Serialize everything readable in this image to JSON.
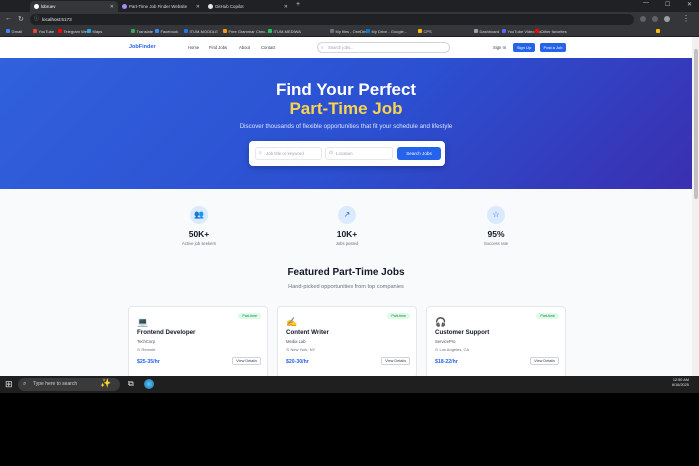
{
  "browser": {
    "tabs": [
      {
        "label": "lobruev",
        "active": true
      },
      {
        "label": "Part-Time Job Finder Website",
        "active": false
      },
      {
        "label": "GitHub Copilot",
        "active": false
      }
    ],
    "url": "localhost:5173",
    "bookmarks": [
      "Gmail",
      "YouTube",
      "Telegram Web",
      "Maps",
      "Translate",
      "Facebook",
      "ITUM-MOODLE",
      "Free Grammar Chec...",
      "ITUM-MEDIWA",
      "My files - OneDrive",
      "My Drive - Google...",
      "CPS",
      "Dashboard",
      "YouTube Video Do...",
      "Other favorites"
    ]
  },
  "header": {
    "logo": "JobFinder",
    "nav": [
      "Home",
      "Find Jobs",
      "About",
      "Contact"
    ],
    "search_placeholder": "Search jobs...",
    "signin": "Sign In",
    "signup": "Sign Up",
    "post_job": "Post a Job"
  },
  "hero": {
    "title_line1": "Find Your Perfect",
    "title_line2": "Part-Time Job",
    "subtitle": "Discover thousands of flexible opportunities that fit your schedule and lifestyle",
    "job_placeholder": "Job title or keyword",
    "location_placeholder": "Location",
    "search_button": "Search Jobs"
  },
  "stats": [
    {
      "icon": "users-icon",
      "value": "50K+",
      "label": "Active job seekers"
    },
    {
      "icon": "trending-icon",
      "value": "10K+",
      "label": "Jobs posted"
    },
    {
      "icon": "star-icon",
      "value": "95%",
      "label": "Success rate"
    }
  ],
  "featured": {
    "title": "Featured Part-Time Jobs",
    "subtitle": "Hand-picked opportunities from top companies",
    "jobs": [
      {
        "icon": "💻",
        "badge": "Part-time",
        "title": "Frontend Developer",
        "company": "TechCorp",
        "location": "Remote",
        "pay": "$25-35/hr",
        "button": "View Details"
      },
      {
        "icon": "✍️",
        "badge": "Part-time",
        "title": "Content Writer",
        "company": "Media Lab",
        "location": "New York, NY",
        "pay": "$20-30/hr",
        "button": "View Details"
      },
      {
        "icon": "🎧",
        "badge": "Part-time",
        "title": "Customer Support",
        "company": "ServicePro",
        "location": "Los Angeles, CA",
        "pay": "$18-22/hr",
        "button": "View Details"
      }
    ]
  },
  "taskbar": {
    "search_placeholder": "Type here to search",
    "time": "12:50 AM",
    "date": "6/16/2025"
  }
}
